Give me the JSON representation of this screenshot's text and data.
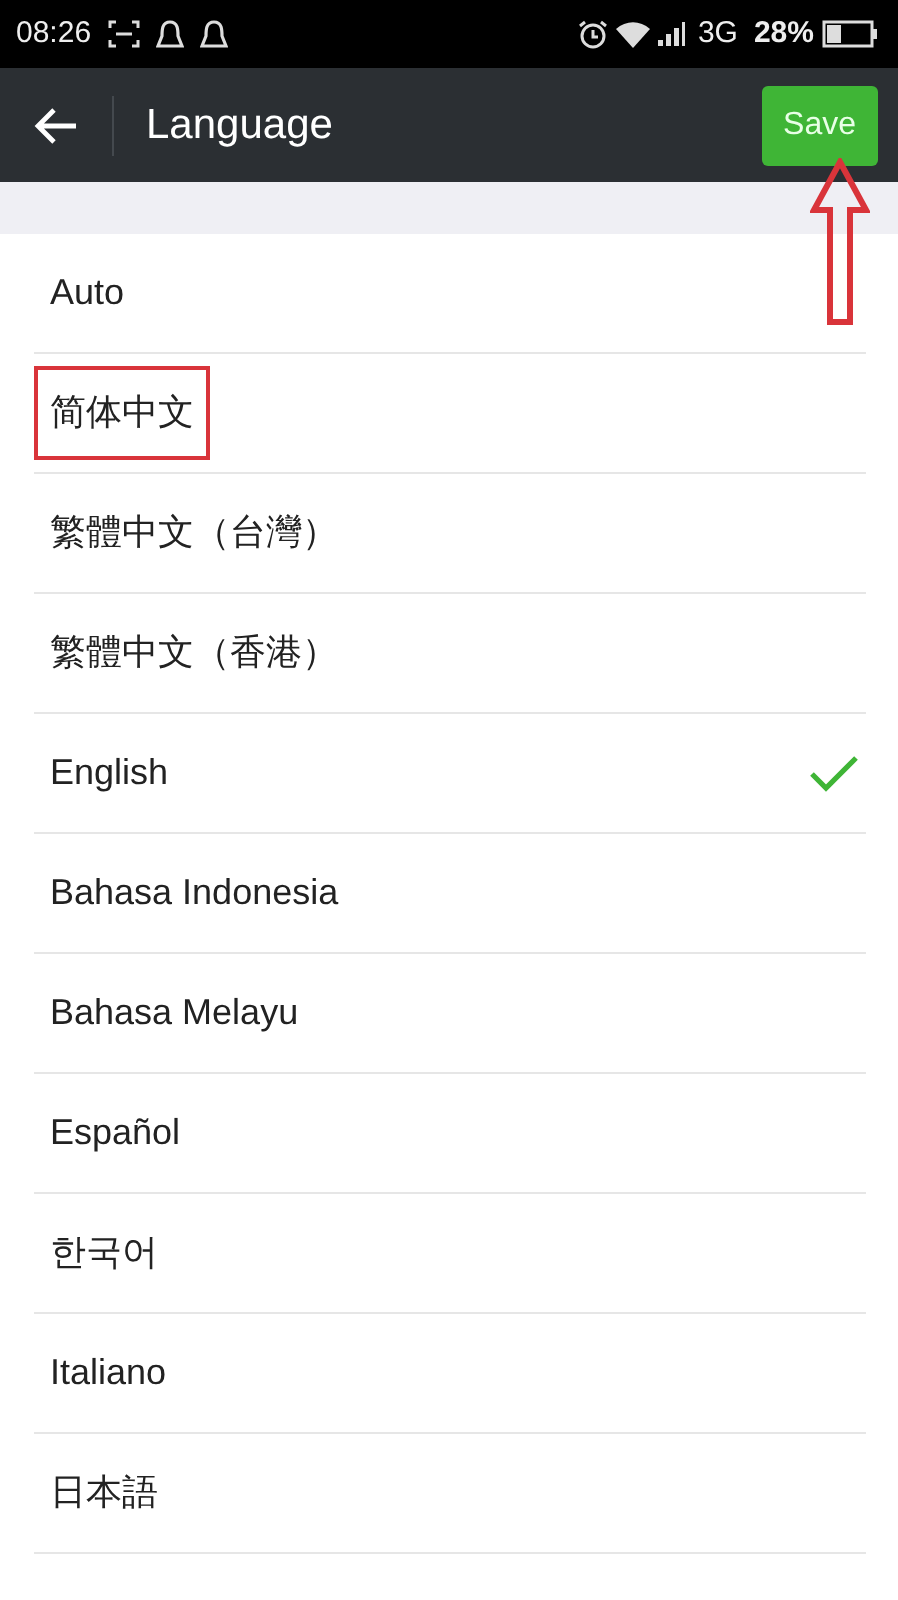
{
  "status_bar": {
    "time": "08:26",
    "network": "3G",
    "battery": "28%"
  },
  "header": {
    "title": "Language",
    "save_button": "Save",
    "save_arrow": true
  },
  "languages": [
    {
      "label": "Auto",
      "selected": false,
      "highlighted": false
    },
    {
      "label": "简体中文",
      "selected": false,
      "highlighted": true
    },
    {
      "label": "繁體中文（台灣）",
      "selected": false,
      "highlighted": false
    },
    {
      "label": "繁體中文（香港）",
      "selected": false,
      "highlighted": false
    },
    {
      "label": "English",
      "selected": true,
      "highlighted": false
    },
    {
      "label": "Bahasa Indonesia",
      "selected": false,
      "highlighted": false
    },
    {
      "label": "Bahasa Melayu",
      "selected": false,
      "highlighted": false
    },
    {
      "label": "Español",
      "selected": false,
      "highlighted": false
    },
    {
      "label": "한국어",
      "selected": false,
      "highlighted": false
    },
    {
      "label": "Italiano",
      "selected": false,
      "highlighted": false
    },
    {
      "label": "日本語",
      "selected": false,
      "highlighted": false
    }
  ]
}
